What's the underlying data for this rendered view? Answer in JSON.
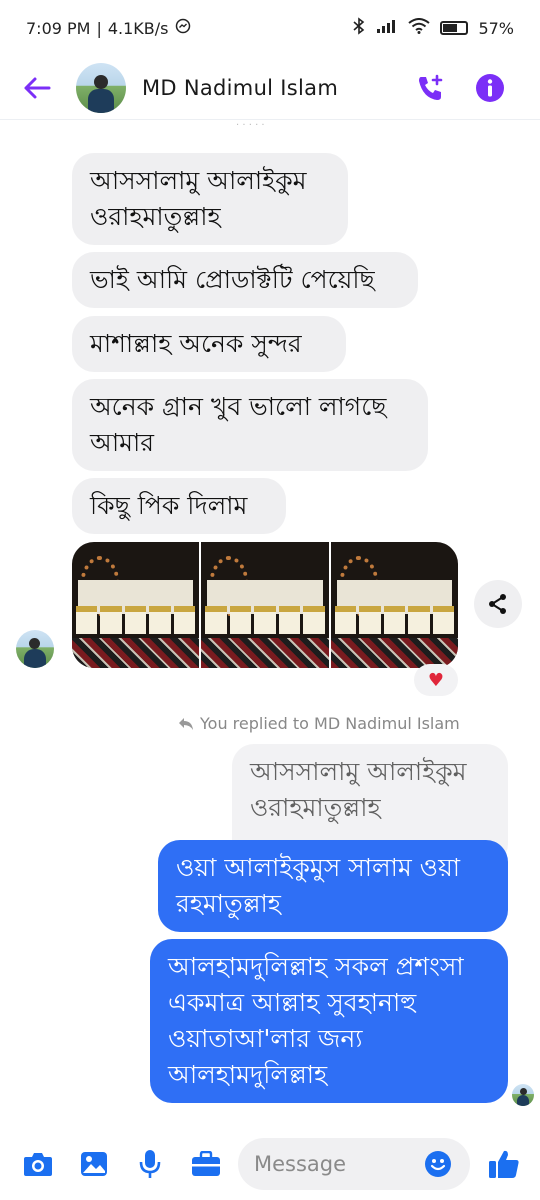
{
  "status": {
    "time": "7:09 PM",
    "speed": "4.1KB/s",
    "battery": "57%",
    "battery_level": 0.57
  },
  "header": {
    "contact_name": "MD Nadimul Islam"
  },
  "messages": {
    "incoming": [
      "আসসালামু আলাইকুম ওরাহমাতুল্লাহ",
      "ভাই আমি প্রোডাক্টটি পেয়েছি",
      "মাশাল্লাহ অনেক সুন্দর",
      "অনেক গ্রান খুব ভালো লাগছে আমার",
      "কিছু পিক দিলাম"
    ],
    "reply_note": "You replied to MD Nadimul Islam",
    "replied_quote": "আসসালামু আলাইকুম ওরাহমাতুল্লাহ",
    "outgoing": [
      "ওয়া আলাইকুমুস সালাম ওয়া রহমাতুল্লাহ",
      "আলহামদুলিল্লাহ সকল প্রশংসা একমাত্র আল্লাহ সুবহানাহু ওয়াতাআ'লার জন্য আলহামদুলিল্লাহ"
    ]
  },
  "composer": {
    "placeholder": "Message"
  },
  "colors": {
    "accent": "#7b2ff7",
    "outgoing_bubble": "#2f6ff5",
    "incoming_bubble": "#efeff1",
    "composer_icons": "#1b6ff0"
  },
  "icons": {
    "back": "arrow-left-icon",
    "call": "phone-plus-icon",
    "info": "info-icon",
    "share": "share-icon",
    "camera": "camera-icon",
    "gallery": "image-icon",
    "mic": "microphone-icon",
    "apps": "briefcase-icon",
    "emoji": "emoji-icon",
    "like": "thumbs-up-icon"
  }
}
